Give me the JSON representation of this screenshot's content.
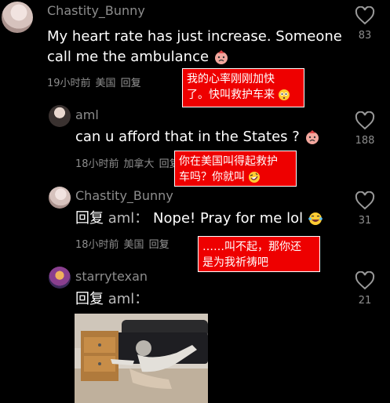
{
  "comments": [
    {
      "username": "Chastity_Bunny",
      "text_line1": "My heart rate has just increase. Someone",
      "text_line2": "call me the ambulance",
      "emoji": "sick-face",
      "time": "19小时前",
      "location": "美国",
      "reply": "回复",
      "likes": "83",
      "note_line1": "我的心率刚刚加快",
      "note_line2": "了。快叫救护车来",
      "note_emoji": "flushed-face"
    },
    {
      "username": "aml",
      "text": "can u afford that in the States ?",
      "emoji": "sick-face",
      "time": "18小时前",
      "location": "加拿大",
      "reply": "回复",
      "likes": "188",
      "note_line1": "你在美国叫得起救护",
      "note_line2": "车吗？你就叫",
      "note_emoji": "rofl-face"
    },
    {
      "username": "Chastity_Bunny",
      "reply_prefix": "回复",
      "mention": "aml：",
      "text": "Nope! Pray for me lol",
      "emoji": "tears-of-joy",
      "time": "18小时前",
      "location": "美国",
      "reply": "回复",
      "likes": "31",
      "note_line1": "……叫不起，那你还",
      "note_line2": "是为我祈祷吧"
    },
    {
      "username": "starrytexan",
      "reply_prefix": "回复",
      "mention": "aml：",
      "likes": "21",
      "image": "person-sliding-off-bed"
    }
  ],
  "colors": {
    "note_bg": "#ee0000",
    "meta": "#8d8d8d",
    "bg": "#000000"
  },
  "icons": {
    "like": "heart-outline-icon"
  }
}
